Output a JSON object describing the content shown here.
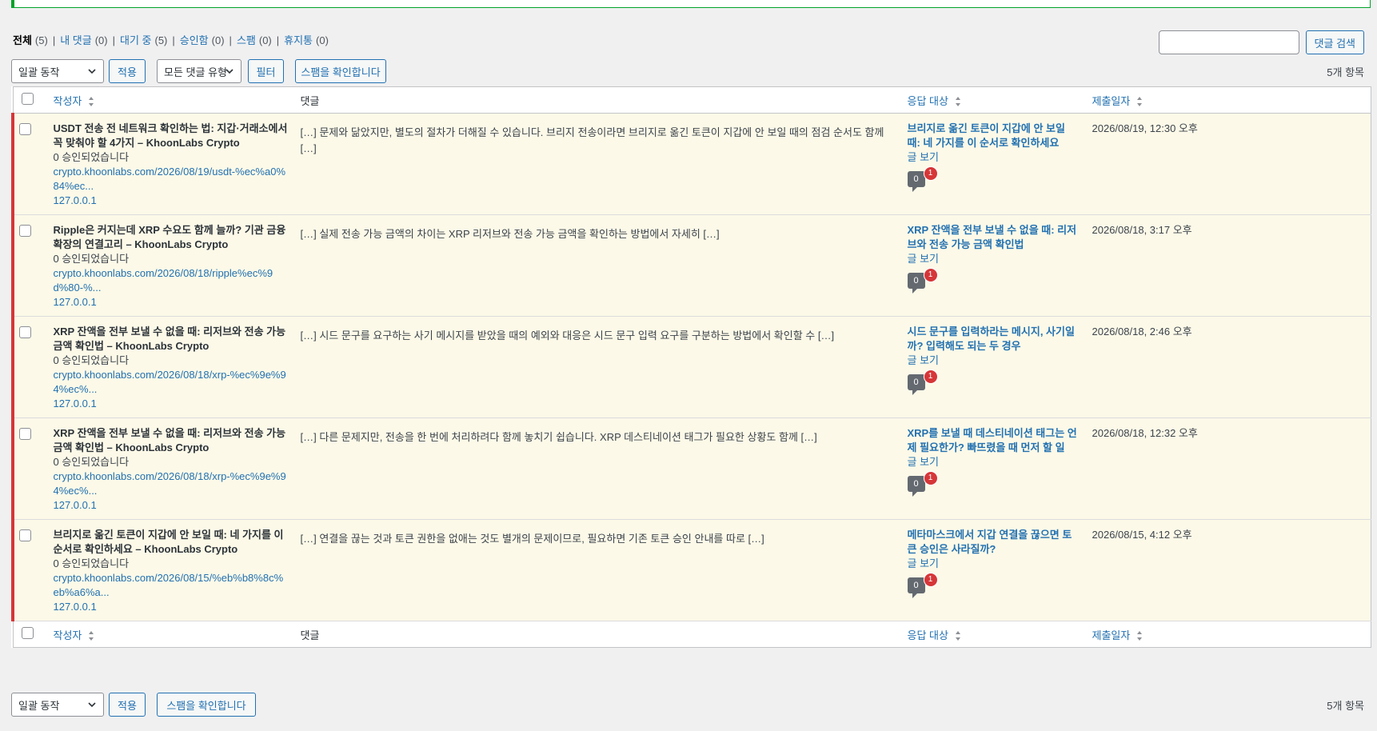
{
  "filters": [
    {
      "label": "전체",
      "count": "(5)",
      "current": true
    },
    {
      "label": "내 댓글",
      "count": "(0)",
      "current": false
    },
    {
      "label": "대기 중",
      "count": "(5)",
      "current": false
    },
    {
      "label": "승인함",
      "count": "(0)",
      "current": false
    },
    {
      "label": "스팸",
      "count": "(0)",
      "current": false
    },
    {
      "label": "휴지통",
      "count": "(0)",
      "current": false
    }
  ],
  "search": {
    "button_label": "댓글 검색",
    "placeholder": ""
  },
  "top_nav": {
    "bulk_action": "일괄 동작",
    "apply": "적용",
    "comment_type": "모든 댓글 유형",
    "filter": "필터",
    "check_spam": "스팸을 확인합니다",
    "items_count": "5개 항목"
  },
  "bottom_nav": {
    "bulk_action": "일괄 동작",
    "apply": "적용",
    "check_spam": "스팸을 확인합니다",
    "items_count": "5개 항목"
  },
  "columns": {
    "author": "작성자",
    "comment": "댓글",
    "response": "응답 대상",
    "date": "제출일자"
  },
  "rows": [
    {
      "author_title": "USDT 전송 전 네트워크 확인하는 법: 지갑·거래소에서 꼭 맞춰야 할 4가지 – KhoonLabs Crypto",
      "approved": "0 승인되었습니다",
      "url": "crypto.khoonlabs.com/2026/08/19/usdt-%ec%a0%84%ec...",
      "ip": "127.0.0.1",
      "comment": "[…] 문제와 닮았지만, 별도의 절차가 더해질 수 있습니다. 브리지 전송이라면 브리지로 옮긴 토큰이 지갑에 안 보일 때의 점검 순서도 함께 […]",
      "resp_title": "브리지로 옮긴 토큰이 지갑에 안 보일 때: 네 가지를 이 순서로 확인하세요",
      "view": "글 보기",
      "bubble": "0",
      "pending": "1",
      "date": "2026/08/19, 12:30 오후"
    },
    {
      "author_title": "Ripple은 커지는데 XRP 수요도 함께 늘까? 기관 금융 확장의 연결고리 – KhoonLabs Crypto",
      "approved": "0 승인되었습니다",
      "url": "crypto.khoonlabs.com/2026/08/18/ripple%ec%9d%80-%...",
      "ip": "127.0.0.1",
      "comment": "[…] 실제 전송 가능 금액의 차이는 XRP 리저브와 전송 가능 금액을 확인하는 방법에서 자세히 […]",
      "resp_title": "XRP 잔액을 전부 보낼 수 없을 때: 리저브와 전송 가능 금액 확인법",
      "view": "글 보기",
      "bubble": "0",
      "pending": "1",
      "date": "2026/08/18, 3:17 오후"
    },
    {
      "author_title": "XRP 잔액을 전부 보낼 수 없을 때: 리저브와 전송 가능 금액 확인법 – KhoonLabs Crypto",
      "approved": "0 승인되었습니다",
      "url": "crypto.khoonlabs.com/2026/08/18/xrp-%ec%9e%94%ec%...",
      "ip": "127.0.0.1",
      "comment": "[…] 시드 문구를 요구하는 사기 메시지를 받았을 때의 예외와 대응은 시드 문구 입력 요구를 구분하는 방법에서 확인할 수 […]",
      "resp_title": "시드 문구를 입력하라는 메시지, 사기일까? 입력해도 되는 두 경우",
      "view": "글 보기",
      "bubble": "0",
      "pending": "1",
      "date": "2026/08/18, 2:46 오후"
    },
    {
      "author_title": "XRP 잔액을 전부 보낼 수 없을 때: 리저브와 전송 가능 금액 확인법 – KhoonLabs Crypto",
      "approved": "0 승인되었습니다",
      "url": "crypto.khoonlabs.com/2026/08/18/xrp-%ec%9e%94%ec%...",
      "ip": "127.0.0.1",
      "comment": "[…] 다른 문제지만, 전송을 한 번에 처리하려다 함께 놓치기 쉽습니다. XRP 데스티네이션 태그가 필요한 상황도 함께 […]",
      "resp_title": "XRP를 보낼 때 데스티네이션 태그는 언제 필요한가? 빠뜨렸을 때 먼저 할 일",
      "view": "글 보기",
      "bubble": "0",
      "pending": "1",
      "date": "2026/08/18, 12:32 오후"
    },
    {
      "author_title": "브리지로 옮긴 토큰이 지갑에 안 보일 때: 네 가지를 이 순서로 확인하세요 – KhoonLabs Crypto",
      "approved": "0 승인되었습니다",
      "url": "crypto.khoonlabs.com/2026/08/15/%eb%b8%8c%eb%a6%a...",
      "ip": "127.0.0.1",
      "comment": "[…] 연결을 끊는 것과 토큰 권한을 없애는 것도 별개의 문제이므로, 필요하면 기존 토큰 승인 안내를 따로 […]",
      "resp_title": "메타마스크에서 지갑 연결을 끊으면 토큰 승인은 사라질까?",
      "view": "글 보기",
      "bubble": "0",
      "pending": "1",
      "date": "2026/08/15, 4:12 오후"
    }
  ]
}
